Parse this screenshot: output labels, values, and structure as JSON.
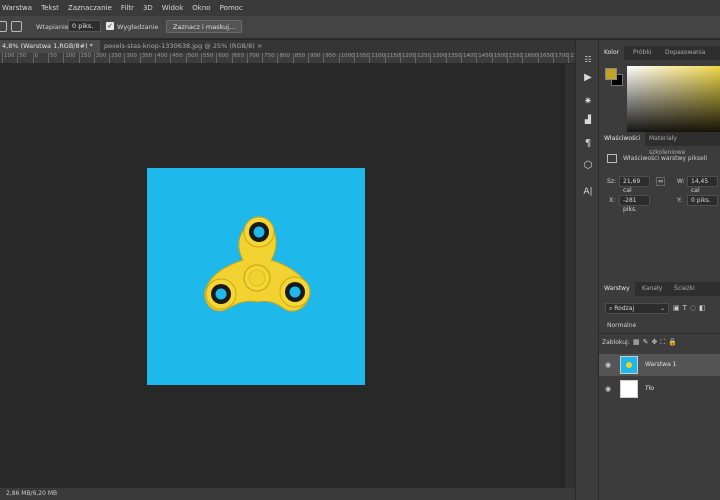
{
  "menu": [
    "Warstwa",
    "Tekst",
    "Zaznaczanie",
    "Filtr",
    "3D",
    "Widok",
    "Okno",
    "Pomoc"
  ],
  "options": {
    "feather_label": "Wtapianie:",
    "feather_value": "0 piks.",
    "smoothing_label": "Wygładzanie",
    "smoothing_checked": true,
    "select_mask_label": "Zaznacz i maskuj..."
  },
  "tabs": [
    {
      "label": "4,8% (Warstwa 1,RGB/8#) *",
      "active": true,
      "close": "×"
    },
    {
      "label": "pexels-stas-knop-1330638.jpg @ 25% (RGB/8)",
      "active": false,
      "close": "×"
    }
  ],
  "ruler_ticks": [
    "100",
    "50",
    "0",
    "50",
    "100",
    "150",
    "200",
    "250",
    "300",
    "350",
    "400",
    "450",
    "500",
    "550",
    "600",
    "650",
    "700",
    "750",
    "800",
    "850",
    "900",
    "950",
    "1000",
    "1050",
    "1100",
    "1150",
    "1200",
    "1250",
    "1300",
    "1350",
    "1400",
    "1450",
    "1500",
    "1550",
    "1600",
    "1650",
    "1700",
    "1750",
    "1800"
  ],
  "status": "2,86 MB/6,20 MB",
  "image": {
    "background": "#1fb8ea",
    "spinner_color": "#f2d230"
  },
  "color_panel": {
    "tabs": [
      "Kolor",
      "Próbki",
      "Dopasowania"
    ],
    "foreground": "#c4a229",
    "background": "#000000"
  },
  "properties": {
    "tabs": [
      "Właściwości",
      "Materiały szkoleniowe"
    ],
    "subtitle": "Właściwości warstwy pikseli",
    "w_label": "Sz:",
    "w_value": "21,69 cal",
    "link_glyph": "⇔",
    "h_label": "W:",
    "h_value": "14,45 cal",
    "x_label": "X:",
    "x_value": "-281 piks.",
    "y_label": "Y:",
    "y_value": "0 piks."
  },
  "layers_panel": {
    "tabs": [
      "Warstwy",
      "Kanały",
      "Ścieżki"
    ],
    "kind_value": "Rodzaj",
    "blend_mode": "Normalne",
    "lock_label": "Zablokuj:",
    "layers": [
      {
        "name": "Warstwa 1",
        "selected": true
      },
      {
        "name": "Tło",
        "selected": false
      }
    ]
  }
}
